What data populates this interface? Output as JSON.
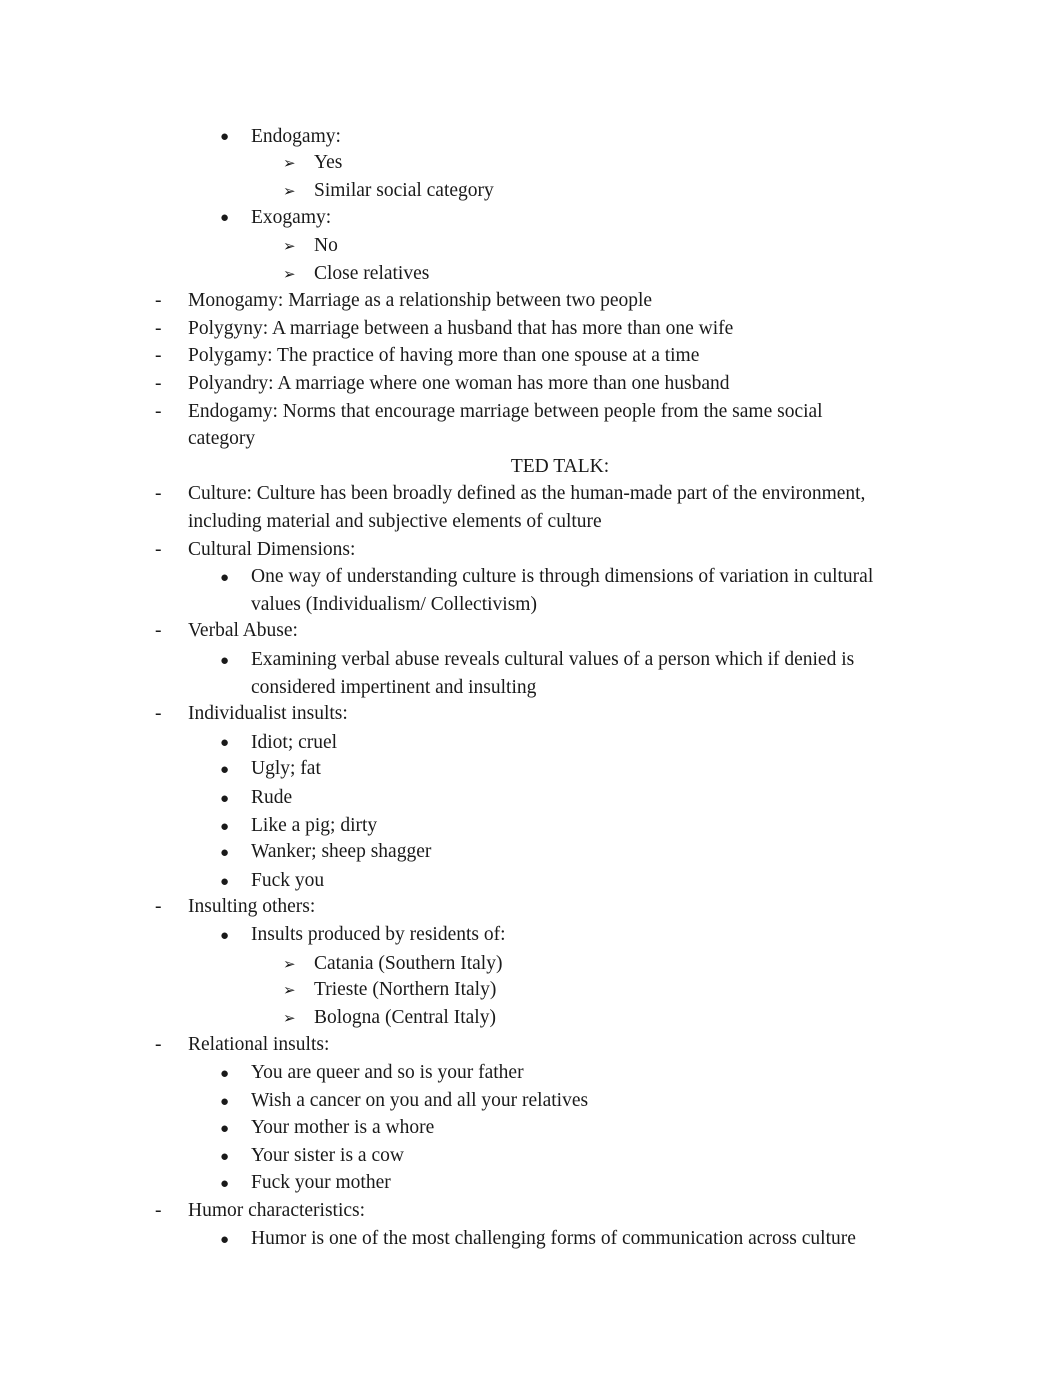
{
  "document": {
    "intro_items": [
      {
        "label": "Endogamy:",
        "sub": [
          "Yes",
          "Similar social category"
        ]
      },
      {
        "label": "Exogamy:",
        "sub": [
          "No",
          "Close relatives"
        ]
      }
    ],
    "definitions": [
      {
        "term": "Monogamy:",
        "text": " Marriage as a relationship between two people"
      },
      {
        "term": "Polygyny:",
        "text": " A marriage between a husband that has more than one wife"
      },
      {
        "term": "Polygamy:",
        "text": " The practice of having more than one spouse at a time"
      },
      {
        "term": "Polyandry:",
        "text": " A marriage where one woman has more than one husband"
      },
      {
        "term": "Endogamy:",
        "text": " Norms that encourage marriage between people from the same social",
        "cont": "category"
      }
    ],
    "ted_heading": "TED TALK:",
    "culture": {
      "term": "Culture:",
      "text": " Culture has been broadly defined as the human-made part of the environment,",
      "cont": "including material and subjective elements of culture"
    },
    "cultural_dimensions": {
      "term": "Cultural Dimensions:",
      "bullet_l1": "One way of understanding culture is through dimensions of variation in cultural",
      "bullet_l2": "values (Individualism/ Collectivism)"
    },
    "verbal_abuse": {
      "term": "Verbal Abuse:",
      "bullet_l1": "Examining verbal abuse reveals cultural values of a person which if denied is",
      "bullet_l2": "considered impertinent and insulting"
    },
    "individualist": {
      "term": "Individualist insults:",
      "items": [
        "Idiot; cruel",
        "Ugly; fat",
        "Rude",
        "Like a pig; dirty",
        "Wanker; sheep shagger",
        "Fuck you"
      ]
    },
    "insulting_others": {
      "term": "Insulting others:",
      "bullet": "Insults produced by residents of:",
      "sub": [
        "Catania (Southern Italy)",
        "Trieste (Northern Italy)",
        "Bologna (Central Italy)"
      ]
    },
    "relational": {
      "term": "Relational insults:",
      "items": [
        "You are queer and so is your father",
        "Wish a cancer on you and all your relatives",
        "Your mother is a whore",
        "Your sister is a cow",
        "Fuck your mother"
      ]
    },
    "humor": {
      "term": "Humor characteristics:",
      "bullet": "Humor is one of the most challenging forms of communication across culture"
    },
    "markers": {
      "dash": "-",
      "bullet": "●",
      "arrow": "➢"
    },
    "highlight_color": "#c5e0b3"
  }
}
